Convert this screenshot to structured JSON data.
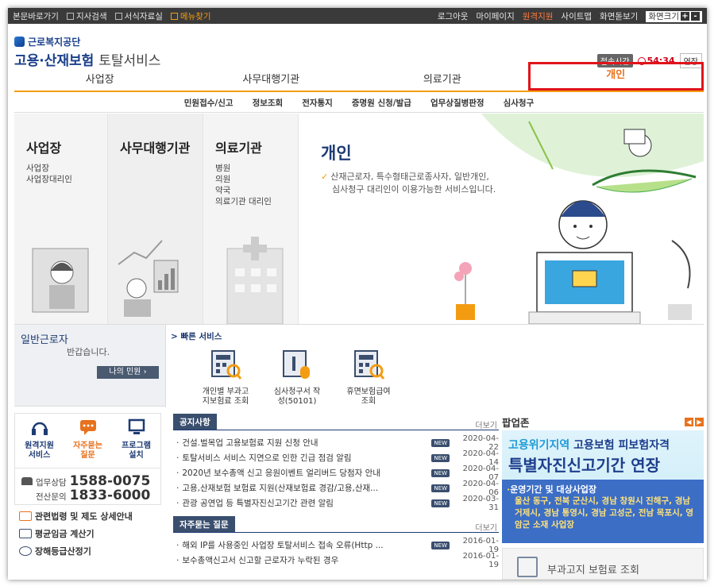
{
  "topbar": {
    "left": [
      "본문바로가기",
      "지사검색",
      "서식자료실",
      "메뉴찾기"
    ],
    "right": [
      "로그아웃",
      "마이페이지",
      "원격지원",
      "사이트맵",
      "화면돋보기"
    ],
    "font_size_label": "화면크기",
    "font_size_plus": "+",
    "font_size_minus": "-"
  },
  "logo": {
    "org": "근로복지공단",
    "service_bold": "고용·산재보험",
    "service_thin": "토탈서비스"
  },
  "session": {
    "label": "접속시간",
    "time": "54:34",
    "extend": "연장"
  },
  "mainnav": [
    "사업장",
    "사무대행기관",
    "의료기관",
    "개인"
  ],
  "subnav": [
    "민원접수/신고",
    "정보조회",
    "전자통지",
    "증명원 신청/발급",
    "업무상질병판정",
    "심사청구"
  ],
  "hero": {
    "col1": {
      "title": "사업장",
      "items": [
        "사업장",
        "사업장대리인"
      ]
    },
    "col2": {
      "title": "사무대행기관"
    },
    "col3": {
      "title": "의료기관",
      "items": [
        "병원",
        "의원",
        "약국",
        "의료기관 대리인"
      ]
    },
    "col4": {
      "title": "개인",
      "desc_line1": "산재근로자, 특수형태근로종사자, 일반개인,",
      "desc_line2": "심사청구 대리인이 이용가능한 서비스입니다."
    }
  },
  "worker": {
    "title": "일반근로자",
    "greeting": "반갑습니다.",
    "button": "나의 민원 ›"
  },
  "quick": {
    "header": "> 빠른 서비스",
    "items": [
      {
        "line1": "개인별 부과고",
        "line2": "지보험료 조회"
      },
      {
        "line1": "심사청구서 작",
        "line2": "성(50101)"
      },
      {
        "line1": "휴면보험급여",
        "line2": "조회"
      }
    ]
  },
  "left_links": [
    {
      "line1": "원격지원",
      "line2": "서비스",
      "icon": "headset-icon"
    },
    {
      "line1": "자주묻는",
      "line2": "질문",
      "icon": "chat-icon"
    },
    {
      "line1": "프로그램",
      "line2": "설치",
      "icon": "monitor-icon"
    }
  ],
  "phones": [
    {
      "label": "업무상담",
      "number": "1588-0075"
    },
    {
      "label": "전산문의",
      "number": "1833-6000"
    }
  ],
  "misc_links": [
    "관련법령 및 제도 상세안내",
    "평균임금 계산기",
    "장해등급산정기"
  ],
  "notice": {
    "tag": "공지사항",
    "more": "더보기",
    "new_label": "NEW",
    "rows": [
      {
        "title": "건설.벌목업 고용보험료 지원 신청 안내",
        "date": "2020-04-22"
      },
      {
        "title": "토탈서비스 서비스 지연으로 인한 긴급 점검 알림",
        "date": "2020-04-14"
      },
      {
        "title": "2020년 보수총액 신고 응원이벤트 얼리버드 당첨자 안내",
        "date": "2020-04-07"
      },
      {
        "title": "고용,산재보험 보험료 지원(산재보험료 경감/고용,산재...",
        "date": "2020-04-06"
      },
      {
        "title": "관광 공연업 등 특별자진신고기간 관련 알림",
        "date": "2020-03-31"
      }
    ]
  },
  "faq": {
    "tag": "자주묻는 질문",
    "more": "더보기",
    "new_label": "NEW",
    "rows": [
      {
        "title": "해외 IP를 사용중인 사업장 토탈서비스 접속 오류(Http ...",
        "date": "2016-01-19"
      },
      {
        "title": "보수총액신고서 신고할 근로자가 누락된 경우",
        "date": "2016-01-19"
      }
    ]
  },
  "popup": {
    "header": "팝업존",
    "line1_a": "고용위기지역",
    "line1_b": "고용보험 피보험자격",
    "line2": "특별자진신고기간 연장",
    "line3": "운영기간 및 대상사업장",
    "line4": "울산 동구, 전북 군산시, 경남 창원시 진해구, 경남 거제시, 경남 통영시, 경남 고성군, 전남 목포시, 영암군 소재 사업장",
    "footer": "부과고지 보험료 조회"
  }
}
